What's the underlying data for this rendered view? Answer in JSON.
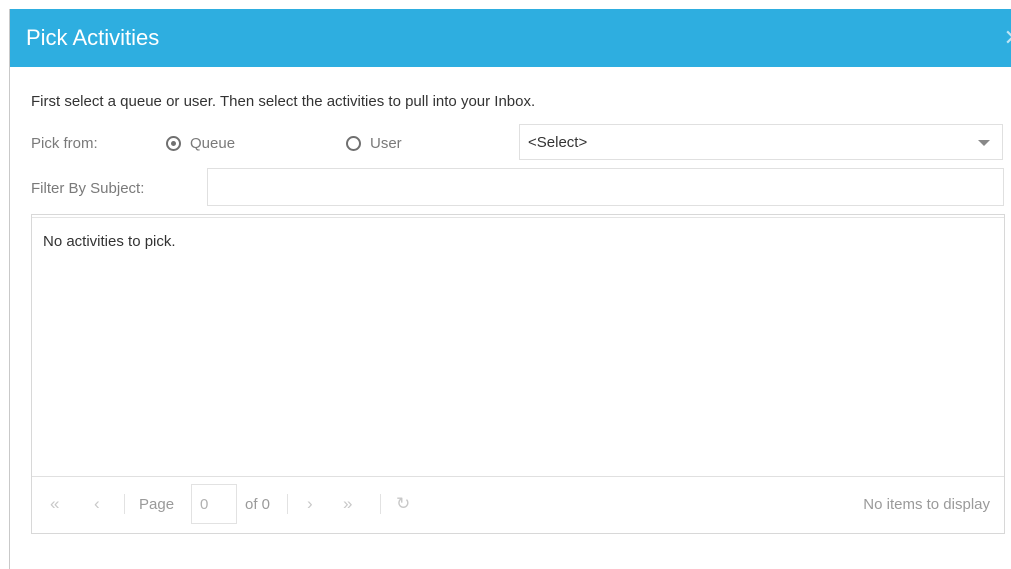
{
  "dialog": {
    "title": "Pick Activities",
    "close_icon": "close-icon",
    "intro": "First select a queue or user. Then select the activities to pull into your Inbox.",
    "pick_from_label": "Pick from:",
    "radio_queue_label": "Queue",
    "radio_queue_checked": true,
    "radio_user_label": "User",
    "radio_user_checked": false,
    "select_value": "<Select>",
    "filter_label": "Filter By Subject:",
    "filter_value": "",
    "empty_message": "No activities to pick."
  },
  "pager": {
    "first_icon": "«",
    "prev_icon": "‹",
    "page_label": "Page",
    "page_value": "0",
    "of_label": "of 0",
    "next_icon": "›",
    "last_icon": "»",
    "refresh_icon": "↻",
    "info": "No items to display"
  },
  "colors": {
    "titlebar": "#2eaee0",
    "label": "#7a7a7a",
    "disabled": "#c8c8c8"
  }
}
